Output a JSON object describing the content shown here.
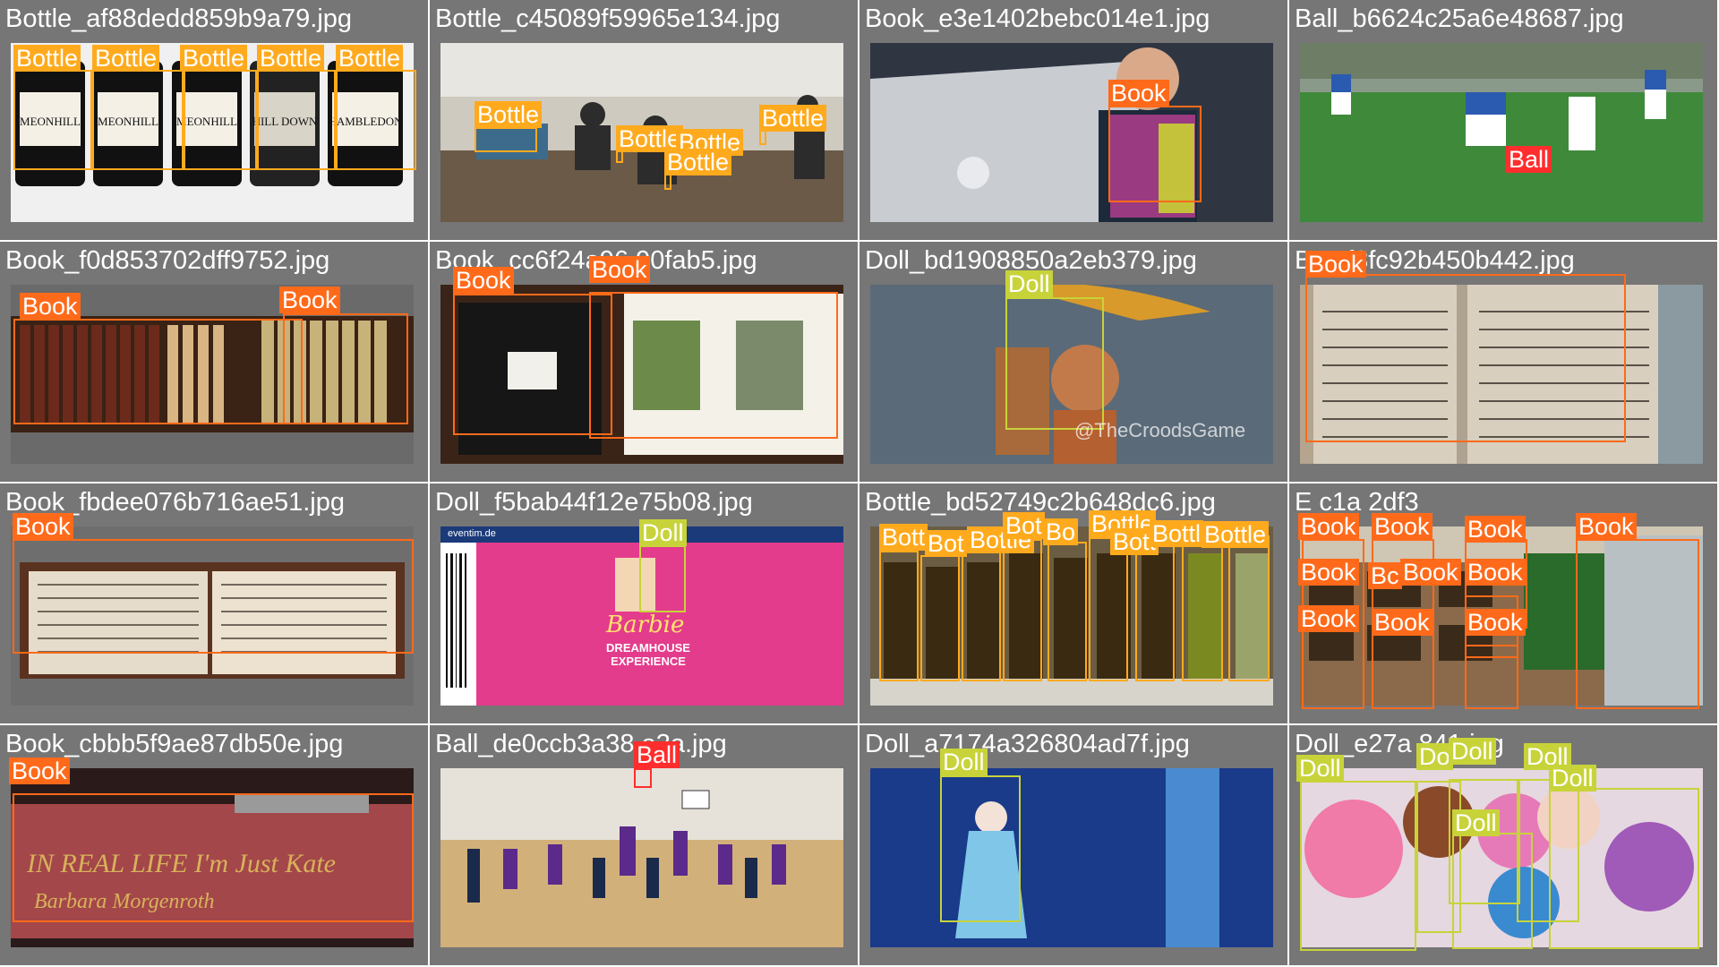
{
  "cells": [
    {
      "file": "Bottle_af88dedd859b9a79.jpg",
      "labels": [
        "Bottle",
        "Bottle",
        "Bottle",
        "Bottle",
        "Bottle"
      ],
      "bottle_texts": [
        "MEONHILL",
        "MEONHILL",
        "MEONHILL",
        "HILL DOWN",
        "HAMBLEDON"
      ]
    },
    {
      "file": "Bottle_c45089f59965e134.jpg",
      "labels": [
        "Bottle",
        "Bottle",
        "Bottle",
        "Bottle",
        "Bottle"
      ]
    },
    {
      "file": "Book_e3e1402bebc014e1.jpg",
      "labels": [
        "Book"
      ]
    },
    {
      "file": "Ball_b6624c25a6e48687.jpg",
      "labels": [
        "Ball"
      ]
    },
    {
      "file": "Book_f0d853702dff9752.jpg",
      "labels": [
        "Book",
        "Book"
      ]
    },
    {
      "file": "Book_cc6f24a96 90fab5.jpg",
      "labels": [
        "Book",
        "Book"
      ]
    },
    {
      "file": "Doll_bd1908850a2eb379.jpg",
      "labels": [
        "Doll"
      ],
      "watermark": "@TheCroodsGame"
    },
    {
      "file": "B caf8fc92b450b442.jpg",
      "labels": [
        "Book"
      ]
    },
    {
      "file": "Book_fbdee076b716ae51.jpg",
      "labels": [
        "Book"
      ]
    },
    {
      "file": "Doll_f5bab44f12e75b08.jpg",
      "labels": [
        "Doll"
      ],
      "ticket": {
        "site": "eventim.de",
        "brand": "Barbie",
        "title": "DREAMHOUSE EXPERIENCE"
      }
    },
    {
      "file": "Bottle_bd52749c2b648dc6.jpg",
      "labels": [
        "Bott",
        "Bot",
        "Bottle",
        "Bot",
        "Bo",
        "Bottle",
        "Bott",
        "Bottl",
        "Bottle"
      ]
    },
    {
      "file": "E c1a 2df3",
      "labels": [
        "Book",
        "Book",
        "Book",
        "Book",
        "Book",
        "Bc",
        "Book",
        "Book",
        "Book",
        "Book",
        "Book"
      ]
    },
    {
      "file": "Book_cbbb5f9ae87db50e.jpg",
      "labels": [
        "Book"
      ],
      "cover": {
        "title": "IN REAL LIFE I'm Just Kate",
        "author": "Barbara Morgenroth"
      }
    },
    {
      "file": "Ball_de0ccb3a38 a3a.jpg",
      "labels": [
        "Ball"
      ]
    },
    {
      "file": "Doll_a7174a326804ad7f.jpg",
      "labels": [
        "Doll"
      ]
    },
    {
      "file": "Doll_e27a 841 jpg",
      "labels": [
        "Doll",
        "Do",
        "Doll",
        "Doll",
        "Doll",
        "Doll"
      ]
    }
  ],
  "colors": {
    "bottle": "#ffaa1d",
    "book": "#ff6a1a",
    "ball": "#ff2d2d",
    "doll": "#c8d33a"
  }
}
